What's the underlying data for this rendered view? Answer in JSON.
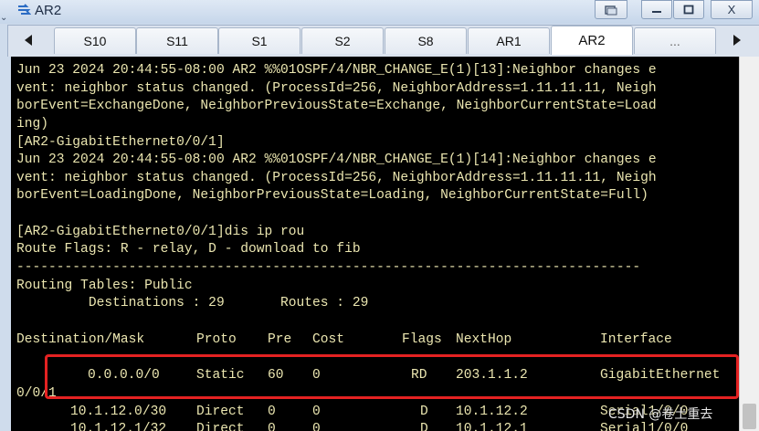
{
  "window": {
    "title": "AR2",
    "controls": [
      "restore-icon",
      "minimize-icon",
      "maximize-icon",
      "close-icon"
    ],
    "close_label": "X"
  },
  "tabs": [
    "S10",
    "S11",
    "S1",
    "S2",
    "S8",
    "AR1",
    "AR2",
    "..."
  ],
  "active_tab": "AR2",
  "console": {
    "lines": [
      "Jun 23 2024 20:44:55-08:00 AR2 %%01OSPF/4/NBR_CHANGE_E(1)[13]:Neighbor changes e",
      "vent: neighbor status changed. (ProcessId=256, NeighborAddress=1.11.11.11, Neigh",
      "borEvent=ExchangeDone, NeighborPreviousState=Exchange, NeighborCurrentState=Load",
      "ing)",
      "[AR2-GigabitEthernet0/0/1]",
      "Jun 23 2024 20:44:55-08:00 AR2 %%01OSPF/4/NBR_CHANGE_E(1)[14]:Neighbor changes e",
      "vent: neighbor status changed. (ProcessId=256, NeighborAddress=1.11.11.11, Neigh",
      "borEvent=LoadingDone, NeighborPreviousState=Loading, NeighborCurrentState=Full)",
      "",
      "[AR2-GigabitEthernet0/0/1]dis ip rou",
      "Route Flags: R - relay, D - download to fib",
      "------------------------------------------------------------------------------",
      "Routing Tables: Public",
      "         Destinations : 29       Routes : 29",
      ""
    ],
    "table_header": {
      "destination": "Destination/Mask",
      "proto": "Proto",
      "pre": "Pre",
      "cost": "Cost",
      "flags": "Flags",
      "nexthop": "NextHop",
      "interface": "Interface"
    },
    "routes": [
      {
        "destination": "0.0.0.0/0",
        "proto": "Static",
        "pre": "60",
        "cost": "0",
        "flags": "RD",
        "nexthop": "203.1.1.2",
        "interface": "GigabitEthernet",
        "wrap": "0/0/1"
      },
      {
        "destination": "10.1.12.0/30",
        "proto": "Direct",
        "pre": "0",
        "cost": "0",
        "flags": "D",
        "nexthop": "10.1.12.2",
        "interface": "Serial1/0/0",
        "wrap": ""
      },
      {
        "destination": "10.1.12.1/32",
        "proto": "Direct",
        "pre": "0",
        "cost": "0",
        "flags": "D",
        "nexthop": "10.1.12.1",
        "interface": "Serial1/0/0",
        "wrap": ""
      }
    ]
  },
  "watermark": "CSDN @卷土重去",
  "colors": {
    "console_bg": "#000000",
    "console_text": "#ebe6b0",
    "highlight_border": "#e42222",
    "titlebar": "#cddcee"
  }
}
